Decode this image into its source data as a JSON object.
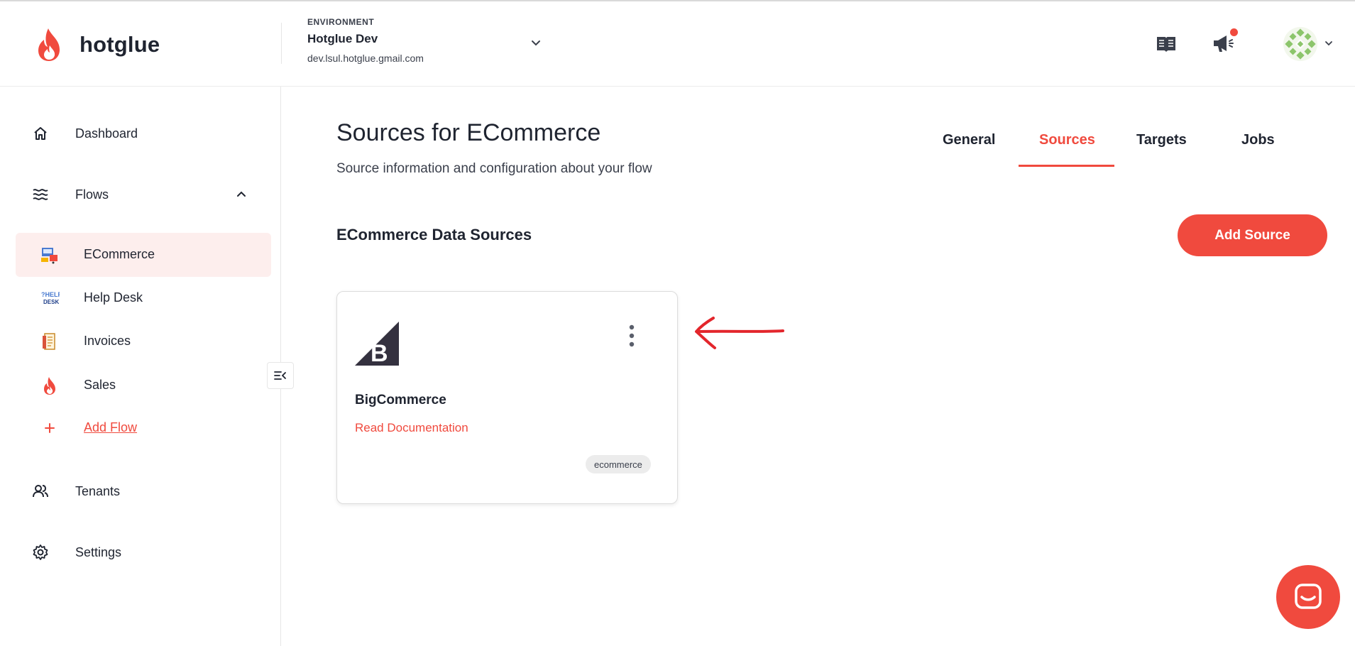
{
  "app": {
    "name": "hotglue"
  },
  "environment": {
    "label": "ENVIRONMENT",
    "name": "Hotglue Dev",
    "email": "dev.lsul.hotglue.gmail.com"
  },
  "header_icons": [
    "book-icon",
    "megaphone-icon",
    "avatar"
  ],
  "sidebar": {
    "items": [
      {
        "label": "Dashboard",
        "icon": "home-icon"
      },
      {
        "label": "Flows",
        "icon": "waves-icon",
        "expanded": true
      },
      {
        "label": "Tenants",
        "icon": "users-icon"
      },
      {
        "label": "Settings",
        "icon": "gear-icon"
      }
    ],
    "flows": [
      {
        "label": "ECommerce",
        "active": true
      },
      {
        "label": "Help Desk"
      },
      {
        "label": "Invoices"
      },
      {
        "label": "Sales"
      },
      {
        "label": "Add Flow"
      }
    ]
  },
  "page": {
    "title": "Sources for ECommerce",
    "subtitle": "Source information and configuration about your flow"
  },
  "tabs": [
    {
      "label": "General"
    },
    {
      "label": "Sources",
      "active": true
    },
    {
      "label": "Targets"
    },
    {
      "label": "Jobs"
    }
  ],
  "section": {
    "title": "ECommerce Data Sources",
    "add_button": "Add Source"
  },
  "sources": [
    {
      "name": "BigCommerce",
      "link": "Read Documentation",
      "tag": "ecommerce"
    }
  ],
  "colors": {
    "accent": "#f04a3e",
    "text": "#1f2430",
    "active_bg": "#fdeeed"
  }
}
